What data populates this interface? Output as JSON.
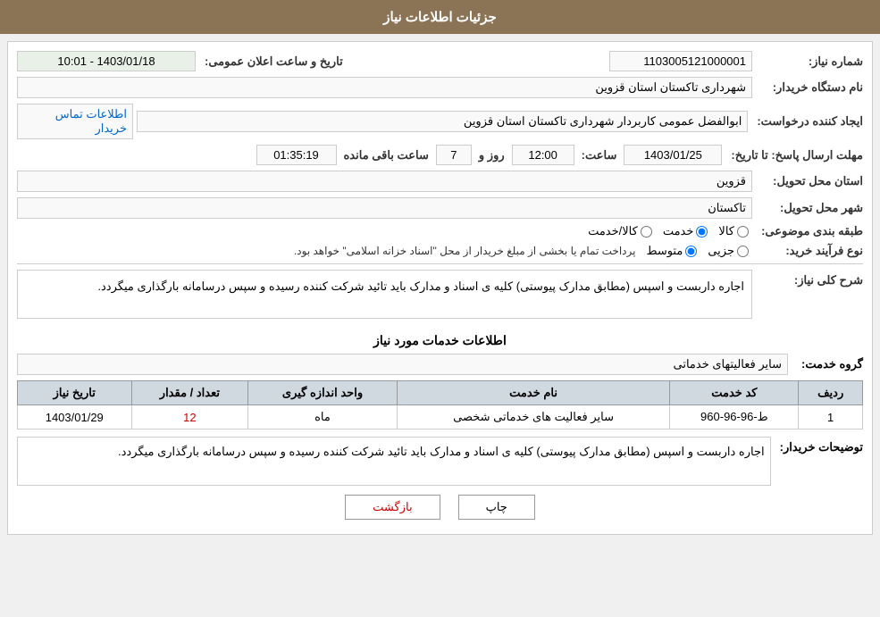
{
  "header": {
    "title": "جزئیات اطلاعات نیاز"
  },
  "fields": {
    "need_number_label": "شماره نیاز:",
    "need_number_value": "1103005121000001",
    "buyer_org_label": "نام دستگاه خریدار:",
    "buyer_org_value": "شهرداری تاکستان استان قزوین",
    "announce_date_label": "تاریخ و ساعت اعلان عمومی:",
    "announce_date_value": "1403/01/18 - 10:01",
    "creator_label": "ایجاد کننده درخواست:",
    "creator_value": "ابوالفضل عمومی کاربردار شهرداری تاکستان استان قزوین",
    "contact_info_label": "اطلاعات تماس خریدار",
    "response_deadline_label": "مهلت ارسال پاسخ: تا تاریخ:",
    "deadline_date": "1403/01/25",
    "deadline_time_label": "ساعت:",
    "deadline_time": "12:00",
    "deadline_days_label": "روز و",
    "deadline_days": "7",
    "remaining_label": "ساعت باقی مانده",
    "remaining_time": "01:35:19",
    "delivery_province_label": "استان محل تحویل:",
    "delivery_province_value": "قزوین",
    "delivery_city_label": "شهر محل تحویل:",
    "delivery_city_value": "تاکستان",
    "category_label": "طبقه بندی موضوعی:",
    "category_options": [
      "کالا",
      "خدمت",
      "کالا/خدمت"
    ],
    "category_selected": "خدمت",
    "process_label": "نوع فرآیند خرید:",
    "process_options": [
      "جزیی",
      "متوسط"
    ],
    "process_note": "پرداخت تمام یا بخشی از مبلغ خریدار از محل \"اسناد خزانه اسلامی\" خواهد بود.",
    "general_desc_label": "شرح کلی نیاز:",
    "general_desc_value": "اجاره داربست و اسپس (مطابق مدارک پیوستی) کلیه ی اسناد و مدارک باید تائید شرکت کننده رسیده و سپس درسامانه بارگذاری میگردد.",
    "services_section_title": "اطلاعات خدمات مورد نیاز",
    "service_group_label": "گروه خدمت:",
    "service_group_value": "سایر فعالیتهای خدماتی",
    "table": {
      "headers": [
        "ردیف",
        "کد خدمت",
        "نام خدمت",
        "واحد اندازه گیری",
        "تعداد / مقدار",
        "تاریخ نیاز"
      ],
      "rows": [
        {
          "row_num": "1",
          "service_code": "ط-96-96-960",
          "service_name": "سایر فعالیت های خدماتی شخصی",
          "unit": "ماه",
          "quantity": "12",
          "need_date": "1403/01/29"
        }
      ]
    },
    "buyer_description_label": "توضیحات خریدار:",
    "buyer_description_value": "اجاره داربست و اسپس (مطابق مدارک پیوستی) کلیه ی اسناد و مدارک باید تائید شرکت کننده رسیده و سپس درسامانه بارگذاری میگردد."
  },
  "buttons": {
    "print_label": "چاپ",
    "back_label": "بازگشت"
  }
}
